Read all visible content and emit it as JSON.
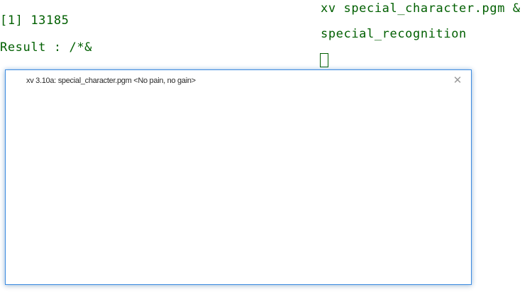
{
  "terminal": {
    "left_lines": [
      "[1] 13185",
      "Result : /*&"
    ],
    "right_lines": [
      "xv special_character.pgm &",
      "special_recognition"
    ]
  },
  "xv_window": {
    "title": "xv 3.10a: special_character.pgm <No pain, no gain>",
    "close_glyph": "✕",
    "accent_color": "#3c8be0"
  },
  "colors": {
    "terminal_text": "#005f00",
    "background": "#ffffff"
  }
}
